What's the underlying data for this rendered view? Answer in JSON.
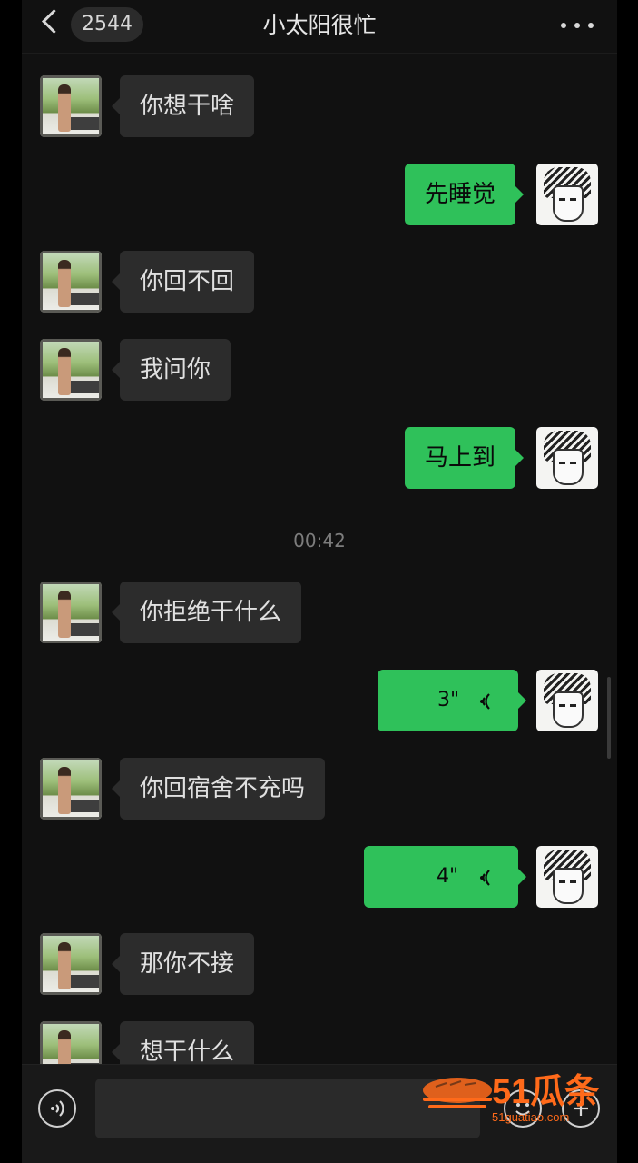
{
  "header": {
    "unread_count": "2544",
    "title": "小太阳很忙"
  },
  "messages": [
    {
      "side": "in",
      "type": "text",
      "text": "你想干啥"
    },
    {
      "side": "out",
      "type": "text",
      "text": "先睡觉"
    },
    {
      "side": "in",
      "type": "text",
      "text": "你回不回"
    },
    {
      "side": "in",
      "type": "text",
      "text": "我问你"
    },
    {
      "side": "out",
      "type": "text",
      "text": "马上到"
    },
    {
      "type": "time",
      "text": "00:42"
    },
    {
      "side": "in",
      "type": "text",
      "text": "你拒绝干什么"
    },
    {
      "side": "out",
      "type": "voice",
      "duration": "3\""
    },
    {
      "side": "in",
      "type": "text",
      "text": "你回宿舍不充吗"
    },
    {
      "side": "out",
      "type": "voice",
      "duration": "4\""
    },
    {
      "side": "in",
      "type": "text",
      "text": "那你不接"
    },
    {
      "side": "in",
      "type": "text",
      "text": "想干什么"
    }
  ],
  "input_bar": {
    "value": ""
  },
  "watermark": {
    "brand": "51瓜条",
    "url": "51guatiao.com"
  },
  "colors": {
    "outgoing_bubble": "#2fc15a",
    "incoming_bubble": "#2c2c2c",
    "background": "#111111",
    "watermark": "#ff6a1a"
  },
  "icons": {
    "back": "chevron-left-icon",
    "more": "more-icon",
    "voice_message": "voice-wave-icon",
    "voice_input": "voice-input-icon",
    "emoji": "emoji-icon",
    "plus": "plus-icon"
  }
}
